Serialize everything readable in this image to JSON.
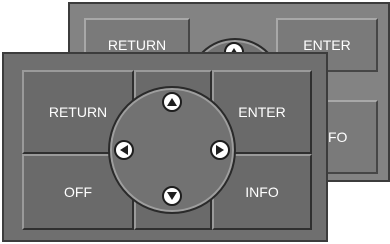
{
  "back_panel": {
    "return_label": "RETURN",
    "enter_label": "ENTER",
    "info_label": "FO"
  },
  "front_panel": {
    "return_label": "RETURN",
    "enter_label": "ENTER",
    "off_label": "OFF",
    "info_label": "INFO"
  },
  "dpad": {
    "up_icon": "arrow-up-icon",
    "down_icon": "arrow-down-icon",
    "left_icon": "arrow-left-icon",
    "right_icon": "arrow-right-icon"
  }
}
